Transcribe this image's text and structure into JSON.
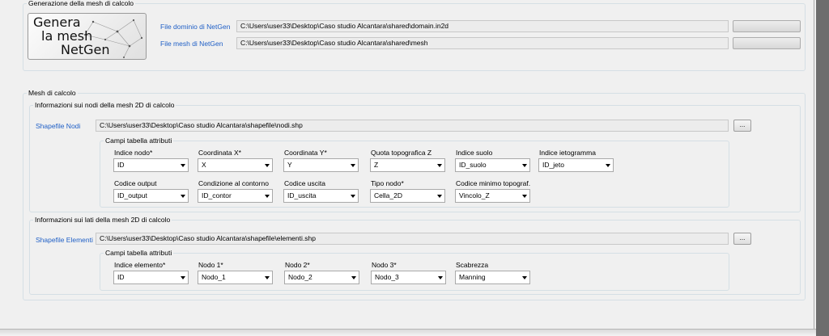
{
  "gen_group": {
    "legend": "Generazione della mesh di calcolo",
    "logo_lines": [
      "Genera",
      "la mesh",
      "NetGen"
    ],
    "domain_label": "File dominio di NetGen",
    "domain_path": "C:\\Users\\user33\\Desktop\\Caso studio Alcantara\\shared\\domain.in2d",
    "mesh_label": "File mesh di NetGen",
    "mesh_path": "C:\\Users\\user33\\Desktop\\Caso studio Alcantara\\shared\\mesh"
  },
  "mesh_group": {
    "legend": "Mesh di calcolo",
    "nodes": {
      "legend": "Informazioni sui nodi della mesh 2D di calcolo",
      "shapefile_label": "Shapefile Nodi",
      "shapefile_path": "C:\\Users\\user33\\Desktop\\Caso studio Alcantara\\shapefile\\nodi.shp",
      "browse_label": "...",
      "fields_legend": "Campi tabella attributi",
      "row1": [
        {
          "label": "Indice nodo*",
          "value": "ID"
        },
        {
          "label": "Coordinata X*",
          "value": "X"
        },
        {
          "label": "Coordinata Y*",
          "value": "Y"
        },
        {
          "label": "Quota topografica Z",
          "value": "Z"
        },
        {
          "label": "Indice suolo",
          "value": "ID_suolo"
        },
        {
          "label": "Indice ietogramma",
          "value": "ID_jeto"
        }
      ],
      "row2": [
        {
          "label": "Codice output",
          "value": "ID_output"
        },
        {
          "label": "Condizione al contorno",
          "value": "ID_contor"
        },
        {
          "label": "Codice uscita",
          "value": "ID_uscita"
        },
        {
          "label": "Tipo nodo*",
          "value": "Cella_2D"
        },
        {
          "label": "Codice minimo topograf.",
          "value": "Vincolo_Z"
        }
      ]
    },
    "elements": {
      "legend": "Informazioni sui lati della mesh 2D di calcolo",
      "shapefile_label": "Shapefile Elementi",
      "shapefile_path": "C:\\Users\\user33\\Desktop\\Caso studio Alcantara\\shapefile\\elementi.shp",
      "browse_label": "...",
      "fields_legend": "Campi tabella attributi",
      "row1": [
        {
          "label": "Indice elemento*",
          "value": "ID"
        },
        {
          "label": "Nodo 1*",
          "value": "Nodo_1"
        },
        {
          "label": "Nodo 2*",
          "value": "Nodo_2"
        },
        {
          "label": "Nodo 3*",
          "value": "Nodo_3"
        },
        {
          "label": "Scabrezza",
          "value": "Manning"
        }
      ]
    }
  }
}
